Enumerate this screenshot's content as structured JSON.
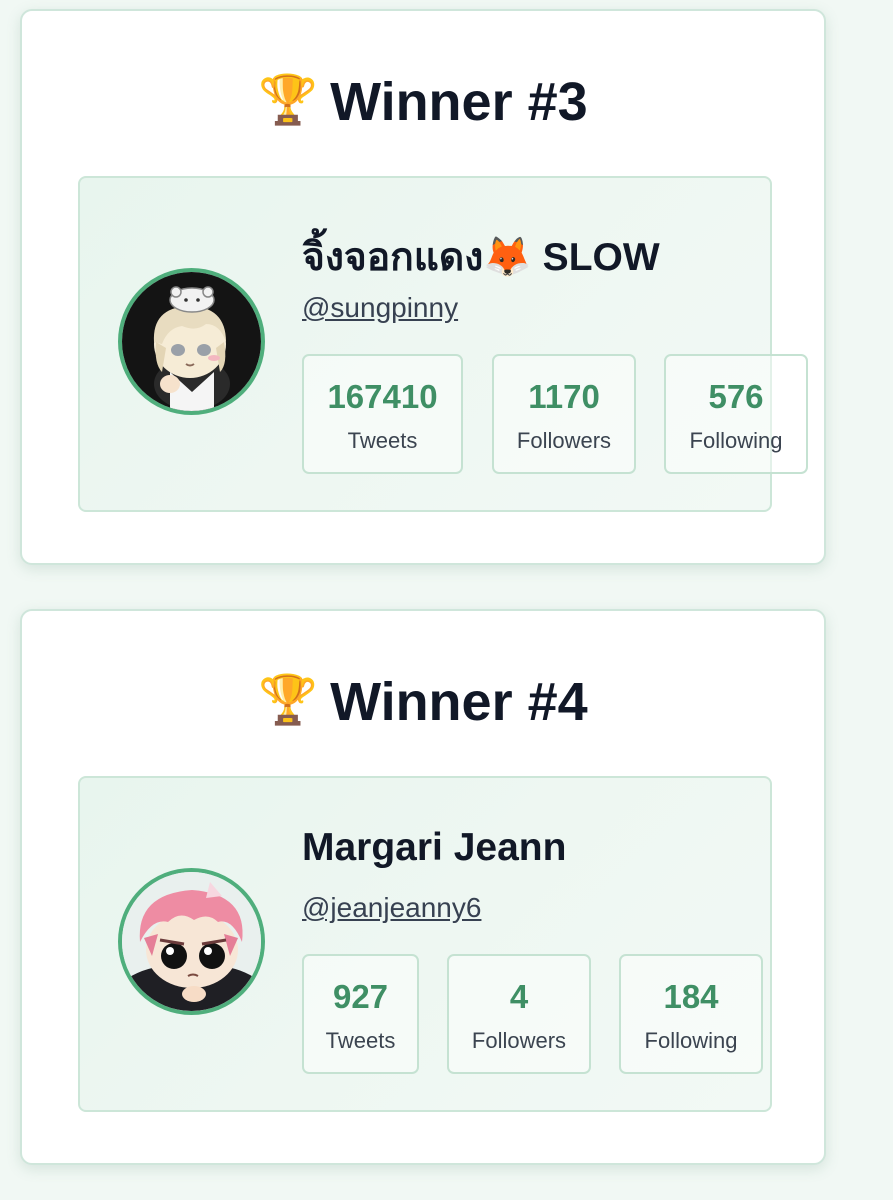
{
  "winners": [
    {
      "title": "Winner #3",
      "trophy_icon": "🏆",
      "display_name": "จิ้งจอกแดง🦊 SLOW",
      "handle": "@sungpinny",
      "stats": [
        {
          "value": "167410",
          "label": "Tweets"
        },
        {
          "value": "1170",
          "label": "Followers"
        },
        {
          "value": "576",
          "label": "Following"
        }
      ]
    },
    {
      "title": "Winner #4",
      "trophy_icon": "🏆",
      "display_name": "Margari Jeann",
      "handle": "@jeanjeanny6",
      "stats": [
        {
          "value": "927",
          "label": "Tweets"
        },
        {
          "value": "4",
          "label": "Followers"
        },
        {
          "value": "184",
          "label": "Following"
        }
      ]
    }
  ],
  "colors": {
    "accent_green": "#3f8f65",
    "avatar_ring": "#4fae7c",
    "panel_border": "#cce6d8",
    "title_text": "#111827"
  }
}
